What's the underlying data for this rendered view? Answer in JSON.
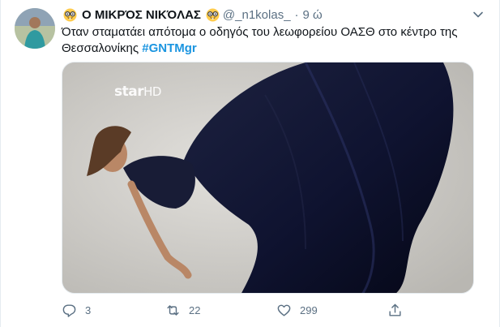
{
  "tweet": {
    "author": {
      "emoji_left": "nerd-face-emoji",
      "display_name": "Ο ΜΙΚΡΌΣ ΝΙΚΌΛΑΣ",
      "emoji_right": "nerd-face-emoji",
      "handle": "@_n1kolas_",
      "separator": "·",
      "time": "9 ώ"
    },
    "text": {
      "line1": "Όταν σταματάει απότομα ο οδηγός του λεωφορείου ΟΑΣΘ στο κέντρο της",
      "line2": "Θεσσαλονίκης",
      "hashtag": "#GNTMgr"
    },
    "media": {
      "watermark_star": "star",
      "watermark_hd": "HD"
    },
    "actions": {
      "reply_count": "3",
      "retweet_count": "22",
      "like_count": "299"
    },
    "colors": {
      "hashtag": "#1b95e0",
      "secondary_text": "#5b7083",
      "primary_text": "#0f1419"
    }
  }
}
